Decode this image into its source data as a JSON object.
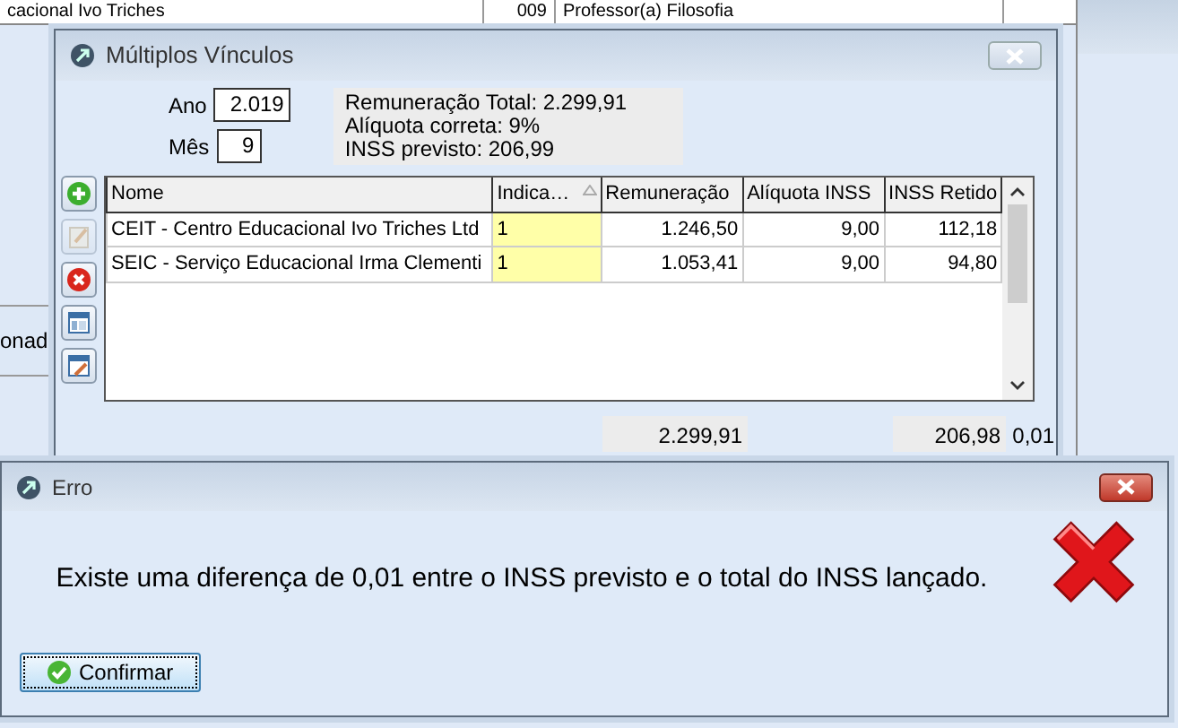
{
  "background": {
    "cells": [
      "cacional Ivo Triches",
      "009",
      "Professor(a) Filosofia"
    ],
    "side_text": "onad"
  },
  "main_window": {
    "title": "Múltiplos Vínculos",
    "ano_label": "Ano",
    "ano": "2.019",
    "mes_label": "Mês",
    "mes": "9",
    "summary": [
      "Remuneração Total: 2.299,91",
      "Alíquota correta: 9%",
      "INSS previsto: 206,99"
    ],
    "toolbar": [
      {
        "kind": "add",
        "disabled": false
      },
      {
        "kind": "edit",
        "disabled": true
      },
      {
        "kind": "delete",
        "disabled": false
      },
      {
        "kind": "layout",
        "disabled": false
      },
      {
        "kind": "customize",
        "disabled": false
      }
    ],
    "table": {
      "columns": [
        {
          "label": "Nome",
          "sorted": false
        },
        {
          "label": "Indica…",
          "sorted": true
        },
        {
          "label": "Remuneração",
          "sorted": false
        },
        {
          "label": "Alíquota INSS",
          "sorted": false
        },
        {
          "label": "INSS Retido",
          "sorted": false
        }
      ],
      "rows": [
        [
          "CEIT - Centro Educacional Ivo Triches Ltd",
          "1",
          "1.246,50",
          "9,00",
          "112,18"
        ],
        [
          "SEIC - Serviço Educacional Irma Clementi",
          "1",
          "1.053,41",
          "9,00",
          "94,80"
        ]
      ]
    },
    "totals": {
      "remuneracao": "2.299,91",
      "inss_retido": "206,98",
      "difference": "0,01"
    }
  },
  "error_dialog": {
    "title": "Erro",
    "message": "Existe uma diferença de 0,01 entre o INSS previsto e o total do INSS lançado.",
    "button": "Confirmar"
  }
}
